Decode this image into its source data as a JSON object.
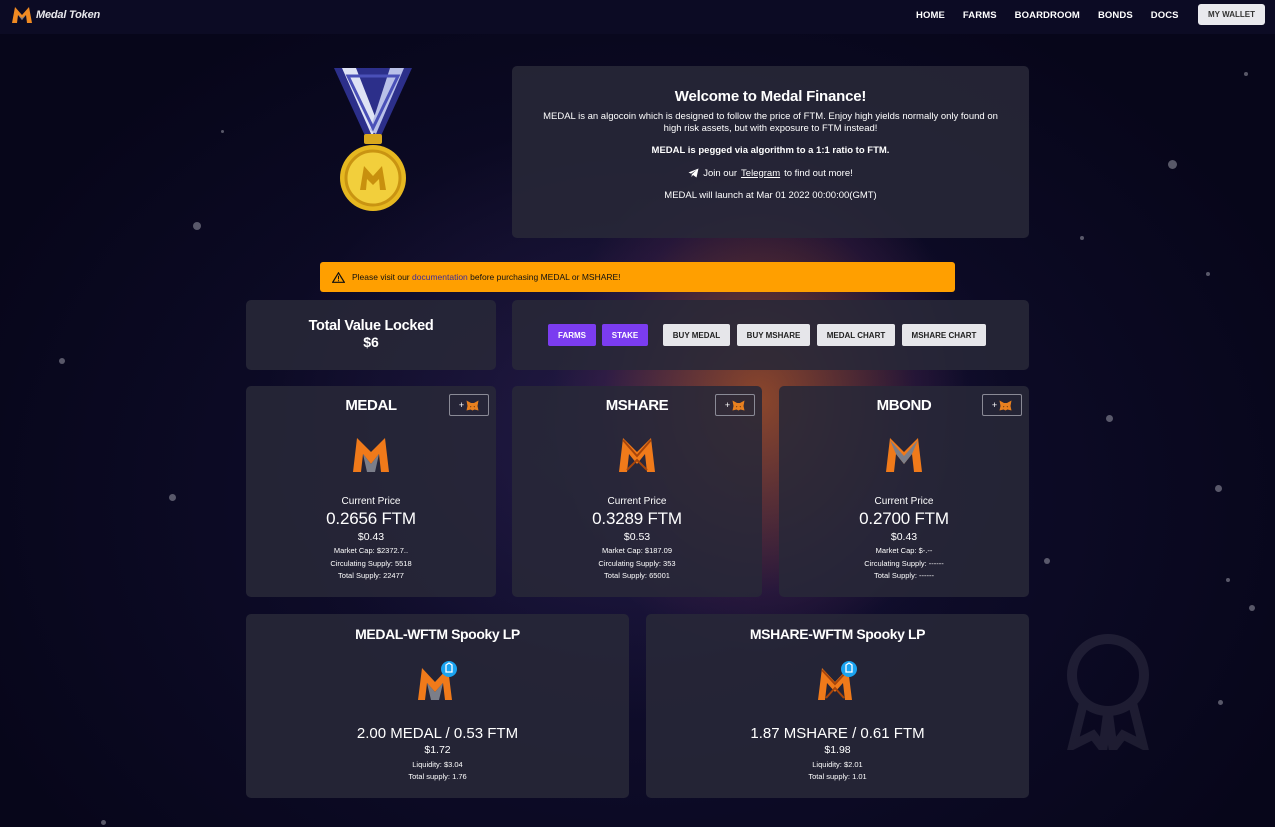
{
  "nav": {
    "logo_text": "Medal Token",
    "links": [
      "HOME",
      "FARMS",
      "BOARDROOM",
      "BONDS",
      "DOCS"
    ],
    "wallet_button": "MY WALLET"
  },
  "welcome": {
    "title": "Welcome to Medal Finance!",
    "description": "MEDAL is an algocoin which is designed to follow the price of FTM. Enjoy high yields normally only found on high risk assets, but with exposure to FTM instead!",
    "peg_text": "MEDAL is pegged via algorithm to a 1:1 ratio to FTM.",
    "telegram_prefix": "Join our",
    "telegram_link": "Telegram",
    "telegram_suffix": "to find out more!",
    "launch_text": "MEDAL will launch at Mar 01 2022 00:00:00(GMT)"
  },
  "alert": {
    "prefix": "Please visit our",
    "link": "documentation",
    "suffix": "before purchasing MEDAL or MSHARE!"
  },
  "tvl": {
    "label": "Total Value Locked",
    "value": "$6"
  },
  "actions": {
    "farms": "FARMS",
    "stake": "STAKE",
    "buy_medal": "BUY MEDAL",
    "buy_mshare": "BUY MSHARE",
    "medal_chart": "MEDAL CHART",
    "mshare_chart": "MSHARE CHART"
  },
  "tokens": [
    {
      "name": "MEDAL",
      "add_label": "+",
      "current_price_label": "Current Price",
      "price": "0.2656 FTM",
      "usd": "$0.43",
      "market_cap": "Market Cap: $2372.7..",
      "circulating_supply": "Circulating Supply: 5518",
      "total_supply": "Total Supply: 22477"
    },
    {
      "name": "MSHARE",
      "add_label": "+",
      "current_price_label": "Current Price",
      "price": "0.3289 FTM",
      "usd": "$0.53",
      "market_cap": "Market Cap: $187.09",
      "circulating_supply": "Circulating Supply: 353",
      "total_supply": "Total Supply: 65001"
    },
    {
      "name": "MBOND",
      "add_label": "+",
      "current_price_label": "Current Price",
      "price": "0.2700 FTM",
      "usd": "$0.43",
      "market_cap": "Market Cap: $-.--",
      "circulating_supply": "Circulating Supply: ------",
      "total_supply": "Total Supply: ------"
    }
  ],
  "lps": [
    {
      "title": "MEDAL-WFTM Spooky LP",
      "pair": "2.00 MEDAL / 0.53 FTM",
      "usd": "$1.72",
      "liquidity": "Liquidity: $3.04",
      "total_supply": "Total supply: 1.76"
    },
    {
      "title": "MSHARE-WFTM Spooky LP",
      "pair": "1.87 MSHARE / 0.61 FTM",
      "usd": "$1.98",
      "liquidity": "Liquidity: $2.01",
      "total_supply": "Total supply: 1.01"
    }
  ],
  "colors": {
    "accent_purple": "#7b3cf0",
    "alert_orange": "#ff9f00",
    "brand_orange": "#f07a1a"
  }
}
